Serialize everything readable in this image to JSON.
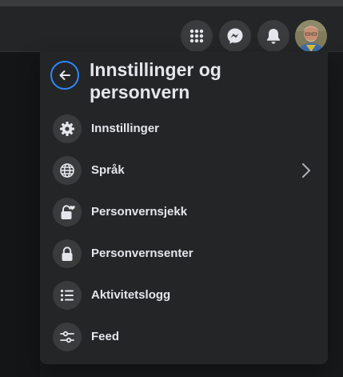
{
  "colors": {
    "background": "#18191a",
    "panel": "#242526",
    "icon_bg": "#3a3b3c",
    "text": "#e4e6eb",
    "accent": "#2d88ff"
  },
  "header": {
    "icons": [
      "menu-grid-icon",
      "messenger-icon",
      "notifications-bell-icon",
      "profile-avatar"
    ]
  },
  "panel": {
    "title": "Innstillinger og personvern",
    "back_icon": "arrow-left-icon",
    "items": [
      {
        "label": "Innstillinger",
        "icon": "gear-icon"
      },
      {
        "label": "Språk",
        "icon": "globe-icon",
        "has_chevron": true
      },
      {
        "label": "Personvernsjekk",
        "icon": "lock-heart-icon"
      },
      {
        "label": "Personvernsenter",
        "icon": "lock-icon"
      },
      {
        "label": "Aktivitetslogg",
        "icon": "list-icon"
      },
      {
        "label": "Feed",
        "icon": "sliders-icon"
      }
    ]
  }
}
